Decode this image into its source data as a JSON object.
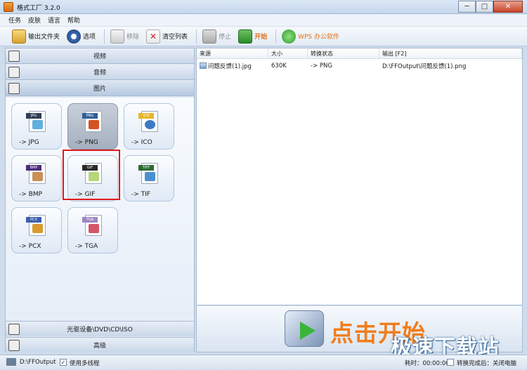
{
  "window": {
    "title": "格式工厂 3.2.0",
    "minimize": "─",
    "maximize": "□",
    "close": "✕"
  },
  "menu": [
    "任务",
    "皮肤",
    "语言",
    "帮助"
  ],
  "toolbar": {
    "output_folder": "输出文件夹",
    "options": "选项",
    "remove": "移除",
    "clear_list": "清空列表",
    "stop": "停止",
    "start": "开始",
    "wps": "WPS 办公软件"
  },
  "categories": {
    "video": "视频",
    "audio": "音频",
    "image": "图片",
    "rom": "光驱设备\\DVD\\CD\\ISO",
    "advanced": "高级"
  },
  "formats": [
    {
      "tag": "JPG",
      "label": "-> JPG",
      "tag_color": "#2f3e52",
      "art_color": "#5fb0de",
      "selected": false
    },
    {
      "tag": "PNG",
      "label": "-> PNG",
      "tag_color": "#2f5f97",
      "art_color": "#d35322",
      "selected": true
    },
    {
      "tag": "ICO",
      "label": "-> ICO",
      "tag_color": "#e8b52a",
      "art_color": "#3a7ac7",
      "selected": false
    },
    {
      "tag": "BMP",
      "label": "-> BMP",
      "tag_color": "#4d2c7a",
      "art_color": "#c98f56",
      "selected": false
    },
    {
      "tag": "GIF",
      "label": "-> GIF",
      "tag_color": "#2a2a2a",
      "art_color": "#b6d67a",
      "selected": false
    },
    {
      "tag": "TIFF",
      "label": "-> TIF",
      "tag_color": "#2d6b35",
      "art_color": "#4a8fd0",
      "selected": false
    },
    {
      "tag": "PCX",
      "label": "-> PCX",
      "tag_color": "#3c5fae",
      "art_color": "#d99a2c",
      "selected": false
    },
    {
      "tag": "TGA",
      "label": "-> TGA",
      "tag_color": "#9d87c2",
      "art_color": "#d45468",
      "selected": false
    }
  ],
  "table": {
    "headers": [
      "来源",
      "大小",
      "转换状态",
      "输出 [F2]"
    ],
    "rows": [
      {
        "source": "问题反馈(1).jpg",
        "size": "630K",
        "status": "-> PNG",
        "output": "D:\\FFOutput\\问题反馈(1).png"
      }
    ]
  },
  "start_text": "点击开始",
  "watermark": "极速下载站",
  "status": {
    "path": "D:\\FFOutput",
    "multithread_label": "使用多线程",
    "multithread_checked": "✓",
    "elapsed": "耗时：00:00:00",
    "after_done_label": "转换完成后：关闭电脑"
  }
}
